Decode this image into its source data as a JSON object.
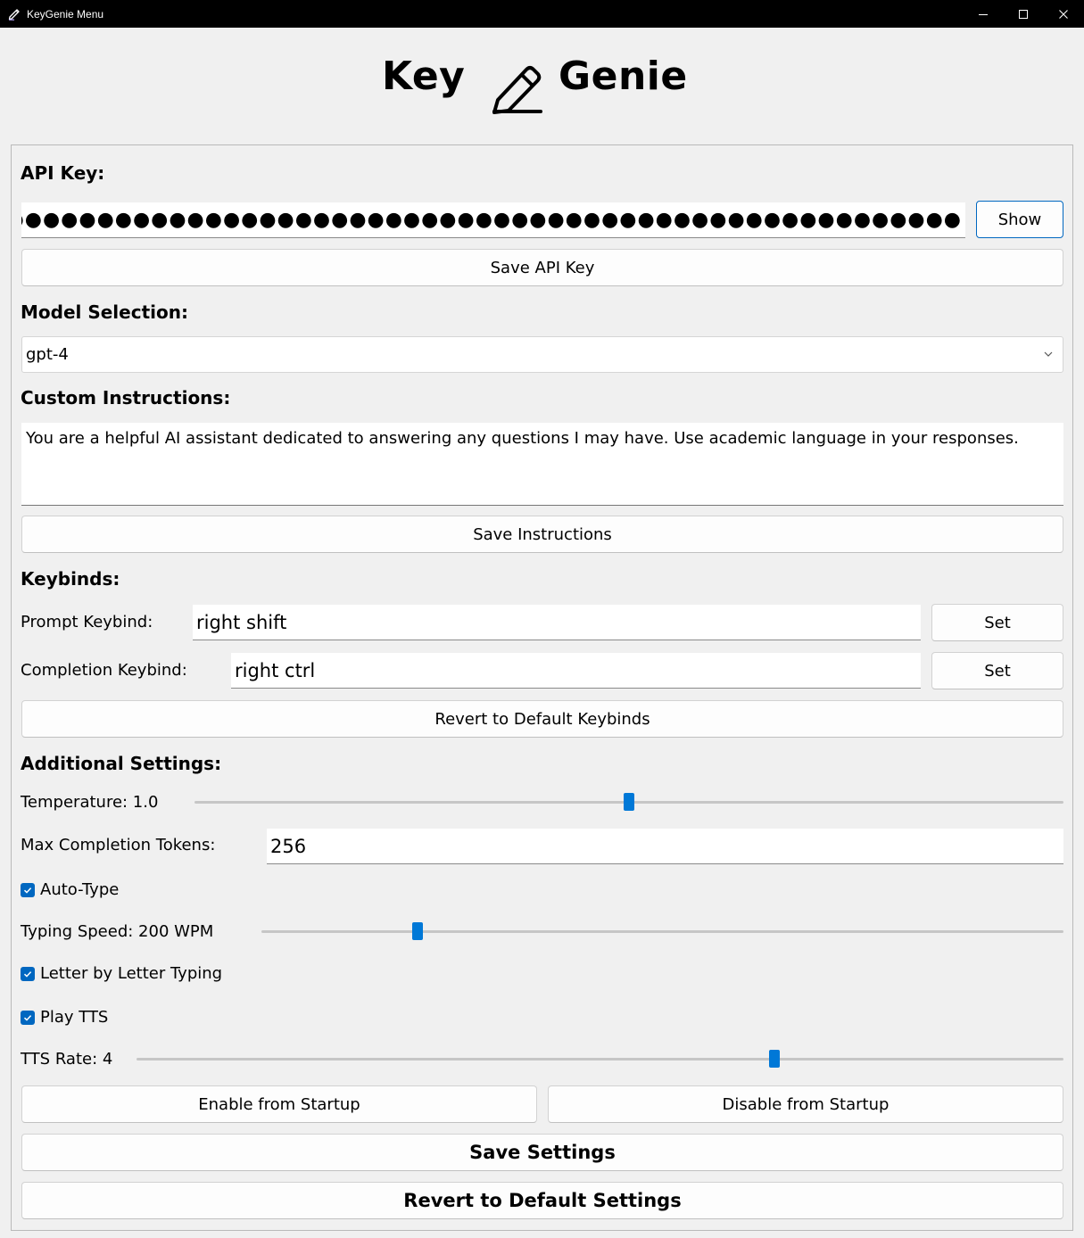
{
  "window": {
    "title": "KeyGenie Menu",
    "icons": {
      "app": "pencil-icon",
      "minimize": "minimize-icon",
      "maximize": "maximize-icon",
      "close": "close-icon"
    }
  },
  "header": {
    "word_left": "Key",
    "word_right": "Genie",
    "logo": "pencil-icon"
  },
  "api": {
    "label": "API Key:",
    "masked_value": "●●●●●●●●●●●●●●●●●●●●●●●●●●●●●●●●●●●●●●●●●●●●●●●●●●●●●●●●●●",
    "show_button": "Show",
    "save_button": "Save API Key"
  },
  "model": {
    "label": "Model Selection:",
    "selected": "gpt-4"
  },
  "instructions": {
    "label": "Custom Instructions:",
    "text": "You are a helpful AI assistant dedicated to answering any questions I may have. Use academic language in your responses.",
    "save_button": "Save Instructions"
  },
  "keybinds": {
    "label": "Keybinds:",
    "prompt_label": "Prompt Keybind:",
    "prompt_value": "right shift",
    "completion_label": "Completion Keybind:",
    "completion_value": "right ctrl",
    "set_button": "Set",
    "revert_button": "Revert to Default Keybinds"
  },
  "settings": {
    "label": "Additional Settings:",
    "temperature_label": "Temperature: 1.0",
    "temperature_fraction": 0.5,
    "max_tokens_label": "Max Completion Tokens:",
    "max_tokens_value": "256",
    "auto_type_label": "Auto-Type",
    "auto_type_checked": true,
    "typing_speed_label": "Typing Speed: 200 WPM",
    "typing_speed_fraction": 0.19,
    "letter_typing_label": "Letter by Letter Typing",
    "letter_typing_checked": true,
    "play_tts_label": "Play TTS",
    "play_tts_checked": true,
    "tts_rate_label": "TTS Rate: 4",
    "tts_rate_fraction": 0.69
  },
  "actions": {
    "enable_startup": "Enable from Startup",
    "disable_startup": "Disable from Startup",
    "save_settings": "Save Settings",
    "revert_settings": "Revert to Default Settings"
  },
  "colors": {
    "accent": "#0078d7",
    "titlebar": "#000000",
    "background": "#f0f0f0"
  }
}
